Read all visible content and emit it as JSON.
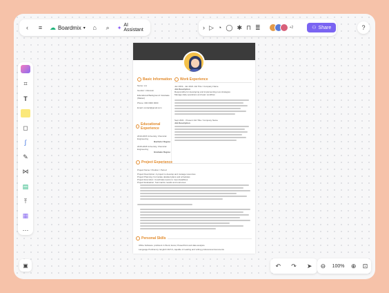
{
  "toolbar": {
    "brand": "Boardmix",
    "ai_label": "AI Assistant",
    "share_label": "Share",
    "avatar_overflow": "+2",
    "help": "?"
  },
  "zoom": {
    "level": "100%"
  },
  "resume": {
    "basic_info": "Basic Information",
    "basic_fields": [
      "Name: xxx",
      "Gender: Unknown",
      "Educational Background: Graduate (Master)",
      "Phone: 000 0000 0000",
      "Email: contact@gmail.com"
    ],
    "educational_experience": "Educational Experience",
    "edu_entries": [
      "2010-2015  University, Chemical Engineering",
      "Bachelor Degree",
      "2015-2018  University, Chemical Engineering",
      "Graduate Degree"
    ],
    "work_experience": "Work Experience",
    "work_entries": [
      "Jan 2019 - Jan 2021 Job Title / Company Name",
      "Job Description",
      "Responsible for developing and implementing new strategies",
      "Manage daily operations and team workflow",
      "Sept 2021 - Present  Job Title / Company Name",
      "Job Description"
    ],
    "project_experience": "Project Experience",
    "project_entries": [
      "Project Name / Position / Period",
      "Project Description: A project to develop and manage resources",
      "Project Planning: Formulate detailed plans and schedules",
      "Project Execution: Coordinate teams to meet deadlines",
      "Project Evaluation: Summarize results and outcomes"
    ],
    "personal_skills": "Personal Skills",
    "skills": [
      "Office Software: proficient in Word, Excel, PowerPoint and data analysis",
      "Language Proficiency: English CET-6, capable of reading and writing professional documents"
    ]
  },
  "colors": {
    "accent": "#7a64f2",
    "resume_accent": "#e28a2b",
    "background": "#f6c2a9"
  }
}
